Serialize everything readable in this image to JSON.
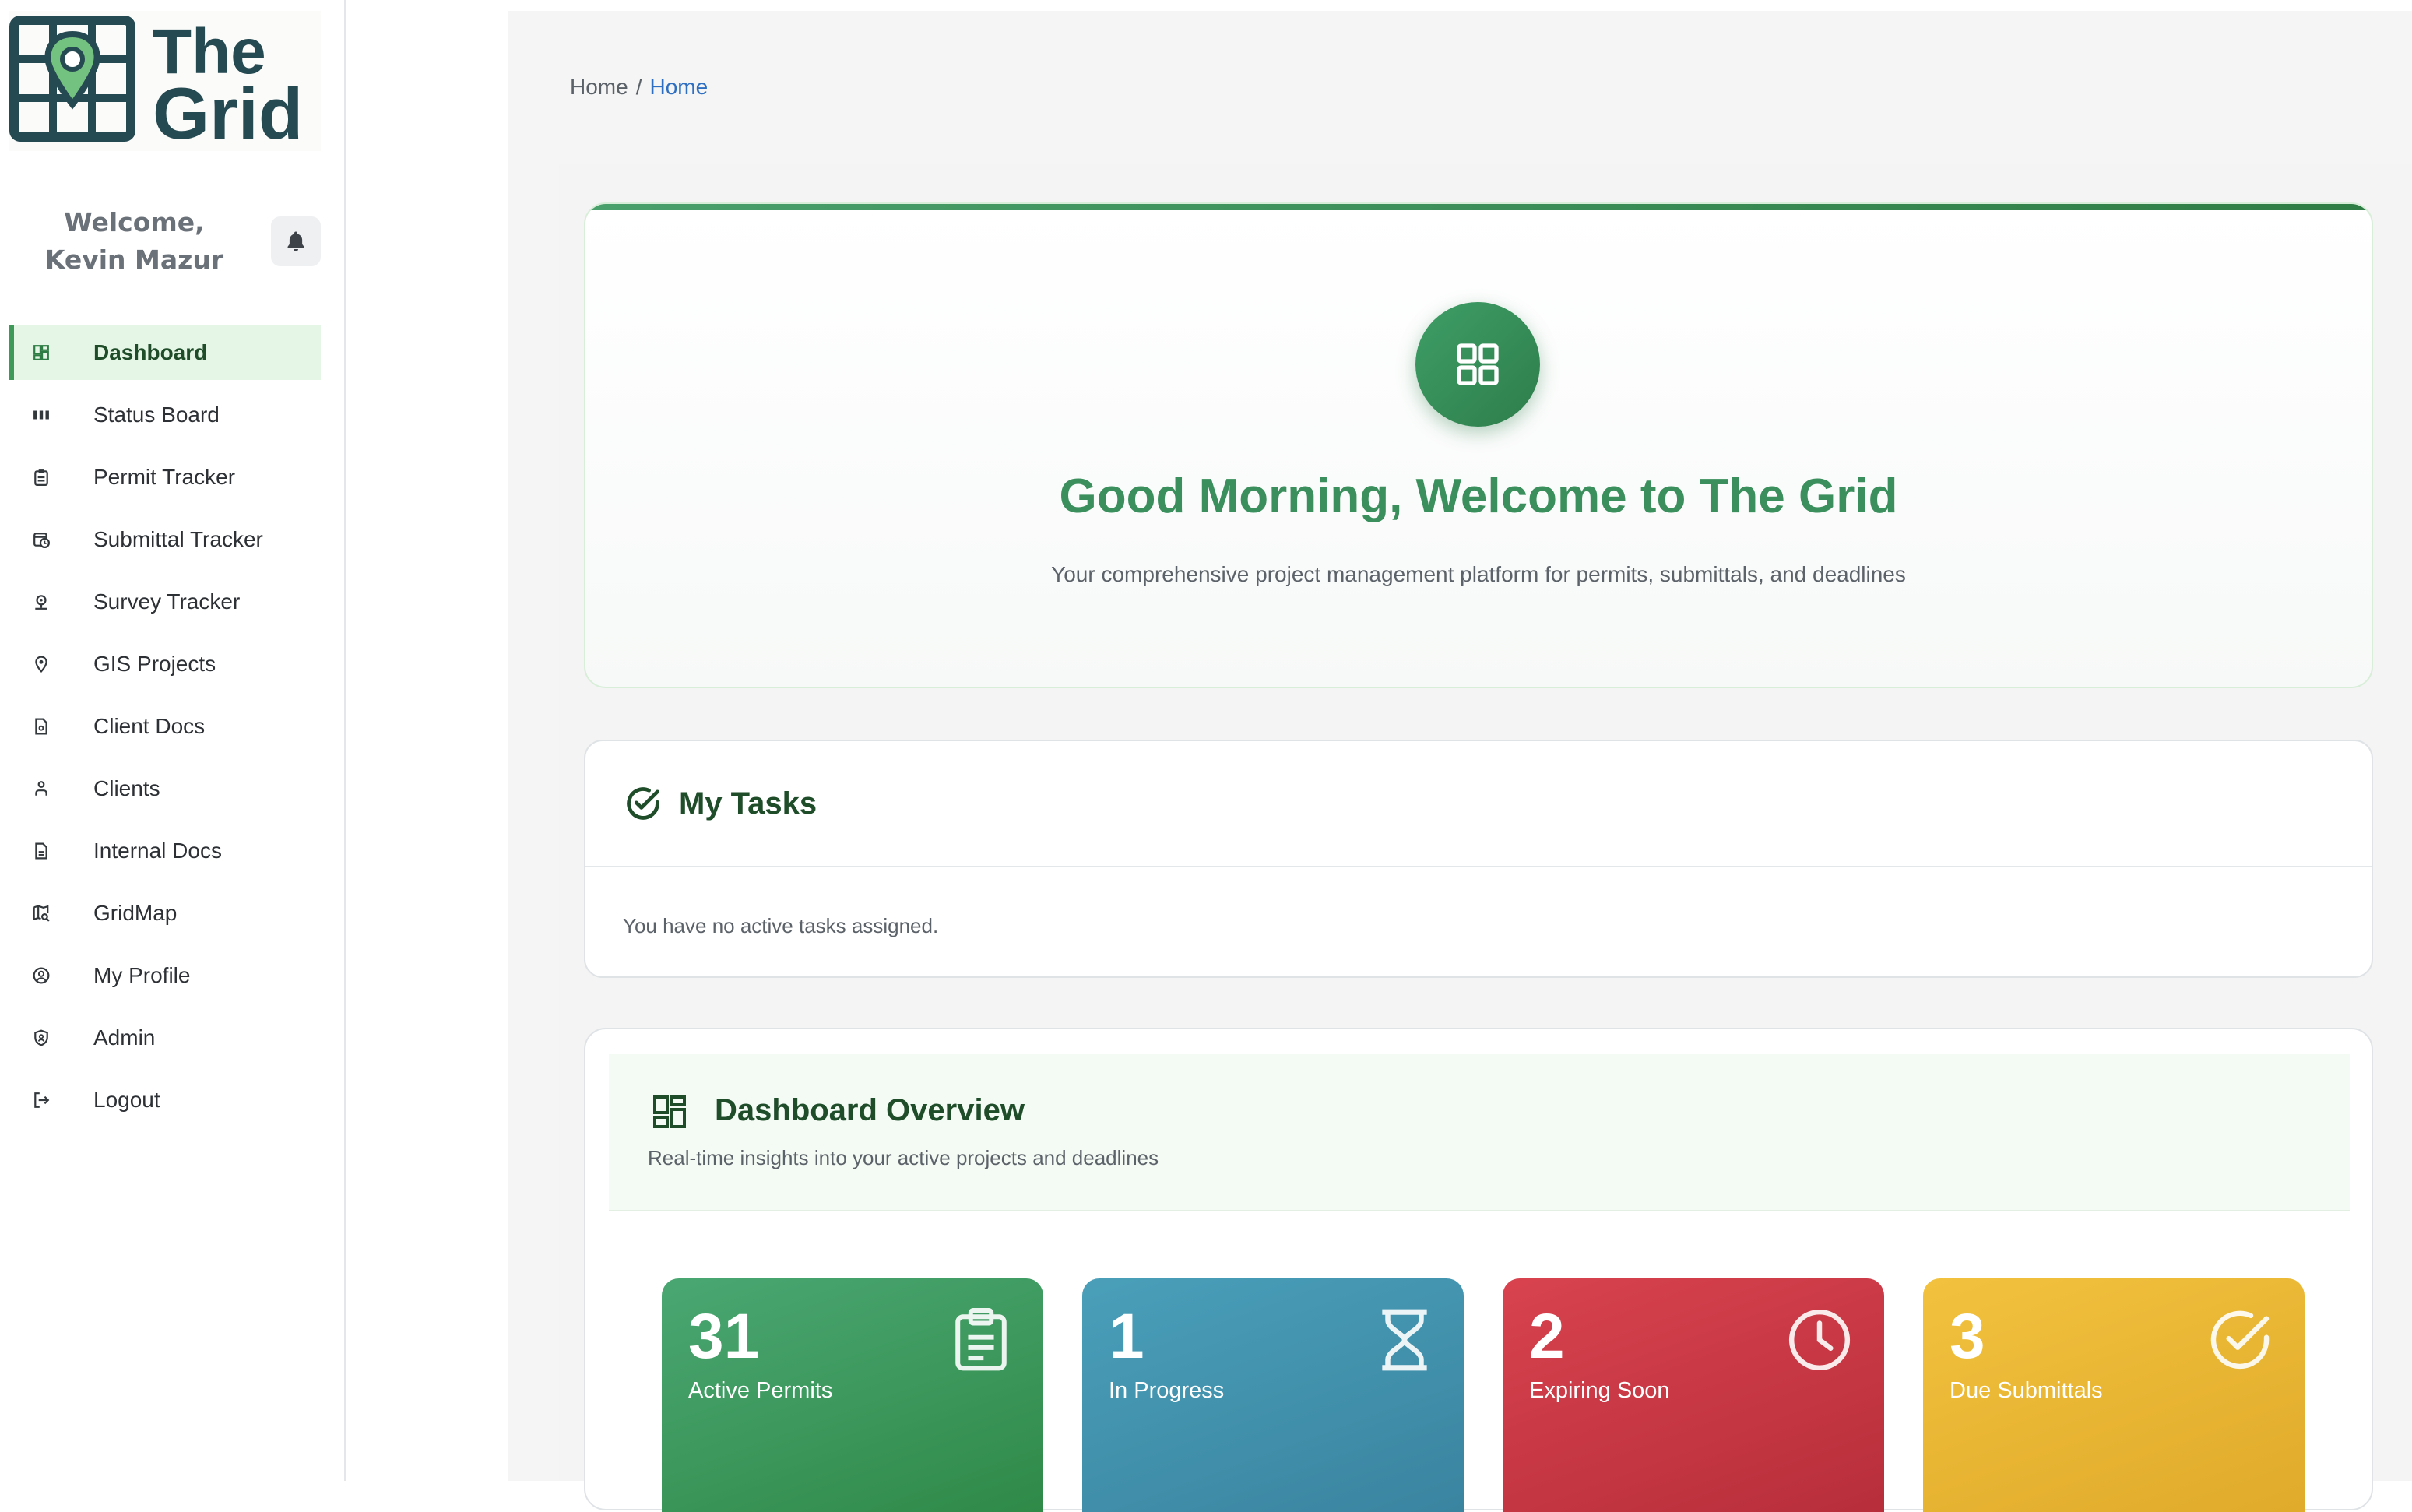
{
  "app": {
    "logo_text_line1": "The",
    "logo_text_line2": "Grid"
  },
  "sidebar": {
    "welcome": "Welcome, Kevin Mazur",
    "items": [
      {
        "label": "Dashboard",
        "icon": "dashboard-icon",
        "active": true
      },
      {
        "label": "Status Board",
        "icon": "board-icon"
      },
      {
        "label": "Permit Tracker",
        "icon": "clipboard-icon"
      },
      {
        "label": "Submittal Tracker",
        "icon": "calendar-clock-icon"
      },
      {
        "label": "Survey Tracker",
        "icon": "map-pin-icon"
      },
      {
        "label": "GIS Projects",
        "icon": "location-icon"
      },
      {
        "label": "Client Docs",
        "icon": "document-icon"
      },
      {
        "label": "Clients",
        "icon": "clients-icon"
      },
      {
        "label": "Internal Docs",
        "icon": "file-icon"
      },
      {
        "label": "GridMap",
        "icon": "map-search-icon"
      },
      {
        "label": "My Profile",
        "icon": "user-circle-icon"
      },
      {
        "label": "Admin",
        "icon": "shield-icon"
      },
      {
        "label": "Logout",
        "icon": "logout-icon"
      }
    ]
  },
  "breadcrumb": {
    "root": "Home",
    "separator": "/",
    "current": "Home"
  },
  "hero": {
    "title": "Good Morning, Welcome to The Grid",
    "subtitle": "Your comprehensive project management platform for permits, submittals, and deadlines"
  },
  "tasks": {
    "title": "My Tasks",
    "empty_message": "You have no active tasks assigned."
  },
  "overview": {
    "title": "Dashboard Overview",
    "subtitle": "Real-time insights into your active projects and deadlines",
    "stats": [
      {
        "value": "31",
        "label": "Active Permits",
        "color": "#3e9a5f",
        "icon": "clipboard-icon"
      },
      {
        "value": "1",
        "label": "In Progress",
        "color": "#4290ac",
        "icon": "hourglass-icon"
      },
      {
        "value": "2",
        "label": "Expiring Soon",
        "color": "#c93843",
        "icon": "clock-icon"
      },
      {
        "value": "3",
        "label": "Due Submittals",
        "color": "#ebb634",
        "icon": "check-circle-icon"
      }
    ]
  },
  "colors": {
    "brand_green": "#3a8f5c",
    "dark_green": "#1f4d2a",
    "link_blue": "#2f6fc1"
  }
}
